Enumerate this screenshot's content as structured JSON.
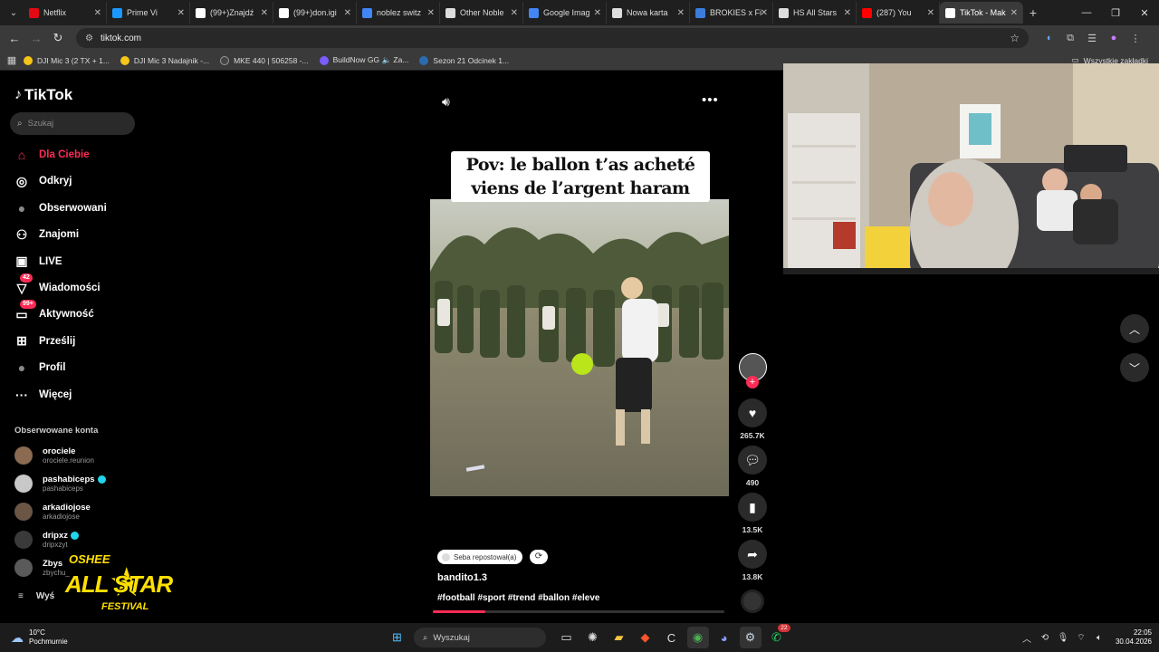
{
  "browser": {
    "tabs": [
      {
        "label": "Netflix",
        "color": "#e50914"
      },
      {
        "label": "Prime Vi",
        "color": "#1a98ff"
      },
      {
        "label": "(99+)Znajdź",
        "color": "#ffffff"
      },
      {
        "label": "(99+)don.igi",
        "color": "#ffffff"
      },
      {
        "label": "noblez switz",
        "color": "#4285f4"
      },
      {
        "label": "Other Noble",
        "color": "#dddddd"
      },
      {
        "label": "Google Imag",
        "color": "#4285f4"
      },
      {
        "label": "Nowa karta",
        "color": "#dddddd"
      },
      {
        "label": "BROKIES x Fi",
        "color": "#3b7ddd"
      },
      {
        "label": "HS All Stars",
        "color": "#dddddd"
      },
      {
        "label": "(287) You",
        "color": "#ff0000"
      },
      {
        "label": "TikTok - Mak",
        "color": "#ffffff"
      }
    ],
    "url": "tiktok.com",
    "bookmarks": [
      "DJI Mic 3 (2 TX + 1...",
      "DJI Mic 3 Nadajnik -...",
      "MKE 440 | 506258 -...",
      "BuildNow GG 🔈 Za...",
      "Sezon 21 Odcinek 1..."
    ],
    "all_bookmarks": "Wszystkie zakładki"
  },
  "tiktok": {
    "logo": "TikTok",
    "search_placeholder": "Szukaj",
    "nav": [
      {
        "label": "Dla Ciebie",
        "icon": "home-icon"
      },
      {
        "label": "Odkryj",
        "icon": "compass-icon"
      },
      {
        "label": "Obserwowani",
        "icon": "avatar-icon"
      },
      {
        "label": "Znajomi",
        "icon": "friends-icon"
      },
      {
        "label": "LIVE",
        "icon": "live-icon"
      },
      {
        "label": "Wiadomości",
        "icon": "messages-icon",
        "badge": "42"
      },
      {
        "label": "Aktywność",
        "icon": "activity-icon",
        "badge": "99+"
      },
      {
        "label": "Prześlij",
        "icon": "upload-icon"
      },
      {
        "label": "Profil",
        "icon": "profile-icon"
      },
      {
        "label": "Więcej",
        "icon": "more-icon"
      }
    ],
    "followed_title": "Obserwowane konta",
    "accounts": [
      {
        "name": "orociele",
        "handle": "orociele.reunion",
        "verified": false
      },
      {
        "name": "pashabiceps",
        "handle": "pashabiceps",
        "verified": true
      },
      {
        "name": "arkadiojose",
        "handle": "arkadiojose",
        "verified": false
      },
      {
        "name": "dripxz",
        "handle": "dripxzyt",
        "verified": true
      },
      {
        "name": "Zbys",
        "handle": "zbychu_",
        "verified": false
      }
    ],
    "see_more": "Wyś",
    "video": {
      "caption_line1": "Pov: le ballon t’as acheté",
      "caption_line2": "viens de l’argent haram",
      "repost_label": "Seba repostował(a)",
      "author": "bandito1.3",
      "hashtags": "#football #sport #trend #ballon #eleve",
      "progress": 0.18
    },
    "actions": {
      "likes": "265.7K",
      "comments": "490",
      "saves": "13.5K",
      "shares": "13.8K"
    }
  },
  "overlay": {
    "brand_top": "OSHEE",
    "brand_main": "ALL STAR",
    "brand_bottom": "FESTIVAL"
  },
  "taskbar": {
    "weather_temp": "10°C",
    "weather_desc": "Pochmurnie",
    "search_placeholder": "Wyszukaj",
    "whatsapp_badge": "22",
    "time": "22:05",
    "date": "30.04.2026"
  }
}
